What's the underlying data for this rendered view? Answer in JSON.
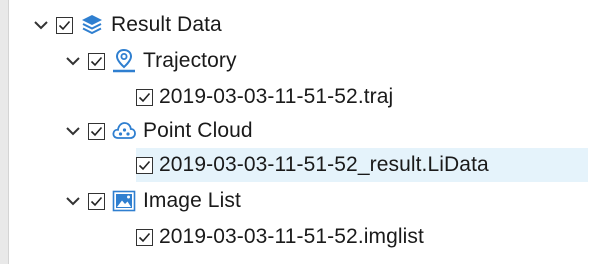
{
  "tree": {
    "root": {
      "label": "Result Data",
      "checked": true,
      "expanded": true,
      "icon": "layers-icon"
    },
    "groups": [
      {
        "label": "Trajectory",
        "checked": true,
        "expanded": true,
        "icon": "location-pin-icon",
        "children": [
          {
            "label": "2019-03-03-11-51-52.traj",
            "checked": true,
            "selected": false
          }
        ]
      },
      {
        "label": "Point Cloud",
        "checked": true,
        "expanded": true,
        "icon": "point-cloud-icon",
        "children": [
          {
            "label": "2019-03-03-11-51-52_result.LiData",
            "checked": true,
            "selected": true
          }
        ]
      },
      {
        "label": "Image List",
        "checked": true,
        "expanded": true,
        "icon": "image-icon",
        "children": [
          {
            "label": "2019-03-03-11-51-52.imglist",
            "checked": true,
            "selected": false
          }
        ]
      }
    ]
  },
  "colors": {
    "icon_blue": "#2f7fd0",
    "selection": "#e5f3fb"
  }
}
